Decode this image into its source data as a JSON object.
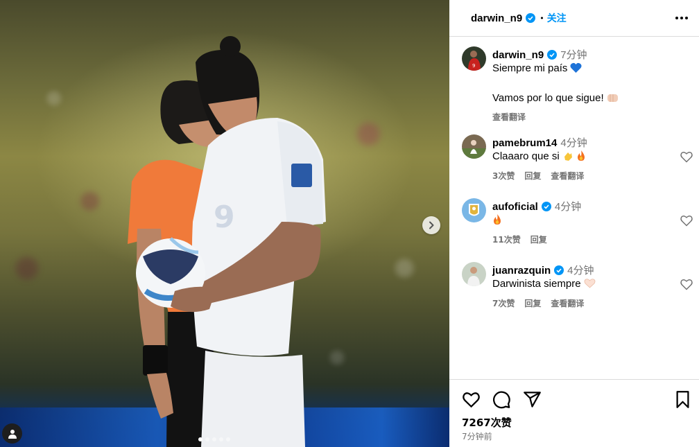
{
  "post": {
    "author": "darwin_n9",
    "follow_label": "关注",
    "separator": "•",
    "carousel": {
      "slides": 5,
      "active_slide": 1
    }
  },
  "caption": {
    "username": "darwin_n9",
    "time": "7分钟",
    "line1": "Siempre mi país",
    "line2": "Vamos por lo que sigue!",
    "translate": "查看翻译"
  },
  "comments": [
    {
      "username": "pamebrum14",
      "time": "4分钟",
      "text": "Claaaro que si",
      "likes": "3次赞",
      "reply": "回复",
      "translate": "查看翻译",
      "verified": false
    },
    {
      "username": "aufoficial",
      "time": "4分钟",
      "text": "",
      "likes": "11次赞",
      "reply": "回复",
      "translate": "",
      "verified": true
    },
    {
      "username": "juanrazquin",
      "time": "4分钟",
      "text": "Darwinista siempre",
      "likes": "7次赞",
      "reply": "回复",
      "translate": "查看翻译",
      "verified": true
    }
  ],
  "footer": {
    "likes": "7267次赞",
    "posted": "7分钟前"
  },
  "icons": {
    "more": "more-options-icon",
    "like": "heart-icon",
    "comment": "comment-icon",
    "share": "share-icon",
    "save": "bookmark-icon",
    "next": "chevron-right-icon",
    "tags": "user-tag-icon"
  },
  "colors": {
    "accent": "#0095f6",
    "muted": "#737373",
    "divider": "#dbdbdb"
  }
}
